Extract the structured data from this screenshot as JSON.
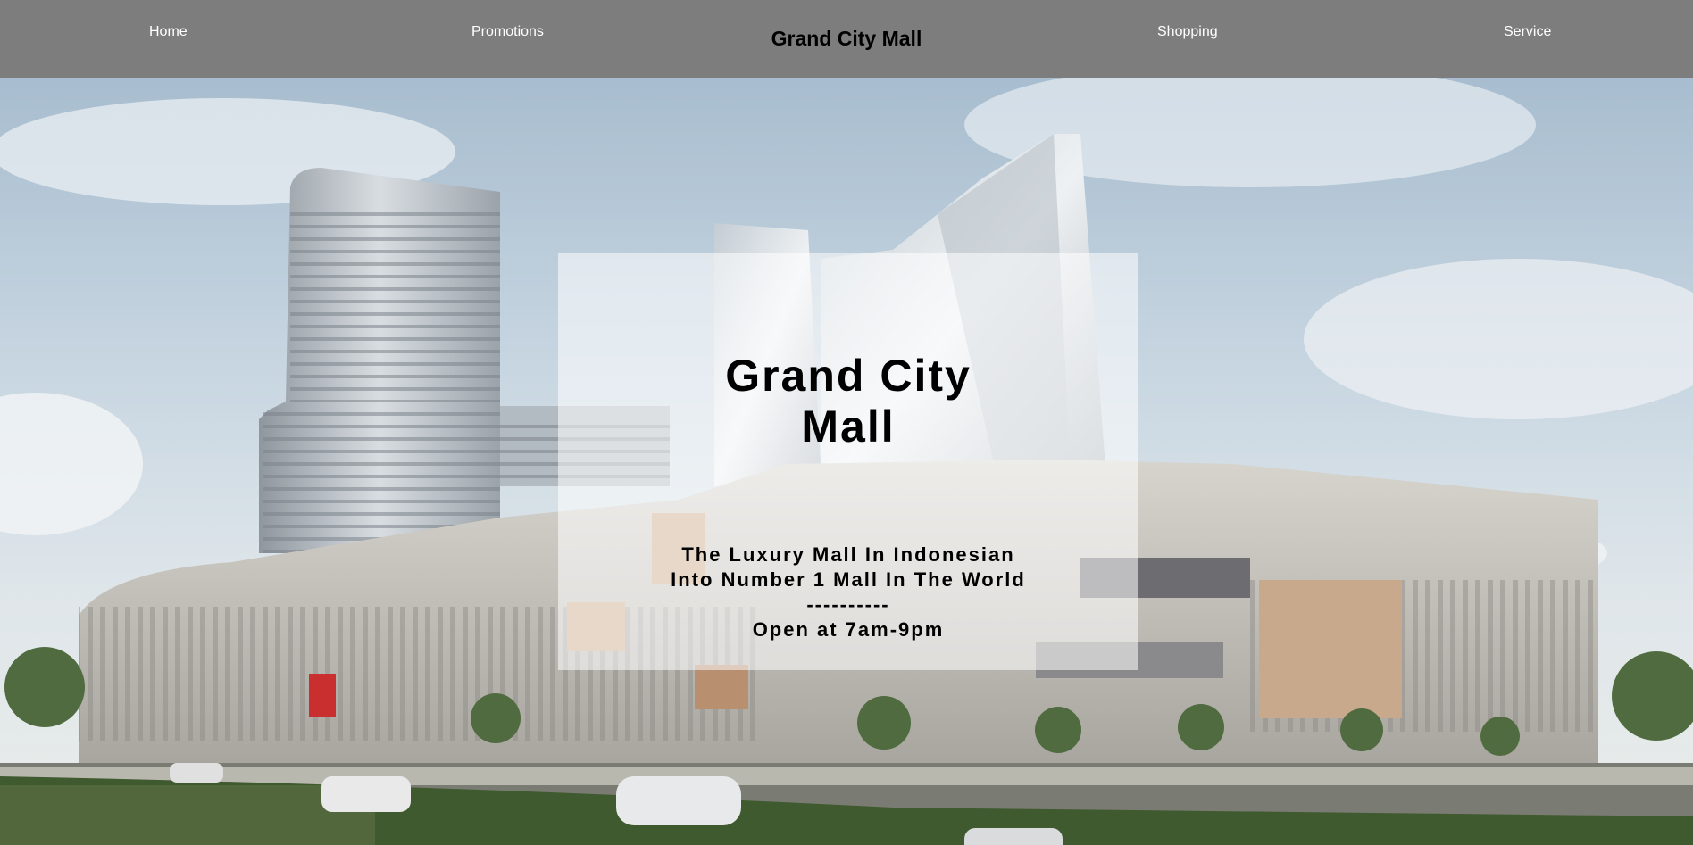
{
  "nav": {
    "home": "Home",
    "promotions": "Promotions",
    "brand": "Grand City Mall",
    "shopping": "Shopping",
    "service": "Service"
  },
  "hero": {
    "title_line1": "Grand City",
    "title_line2": "Mall",
    "tagline_line1": "The Luxury Mall In Indonesian",
    "tagline_line2": "Into Number 1 Mall In The World",
    "divider": "----------",
    "hours": "Open at 7am-9pm",
    "background_image": "mall-building-photo"
  },
  "colors": {
    "navbar_bg": "#7d7d7d",
    "nav_text": "#ffffff",
    "brand_text": "#000000"
  }
}
